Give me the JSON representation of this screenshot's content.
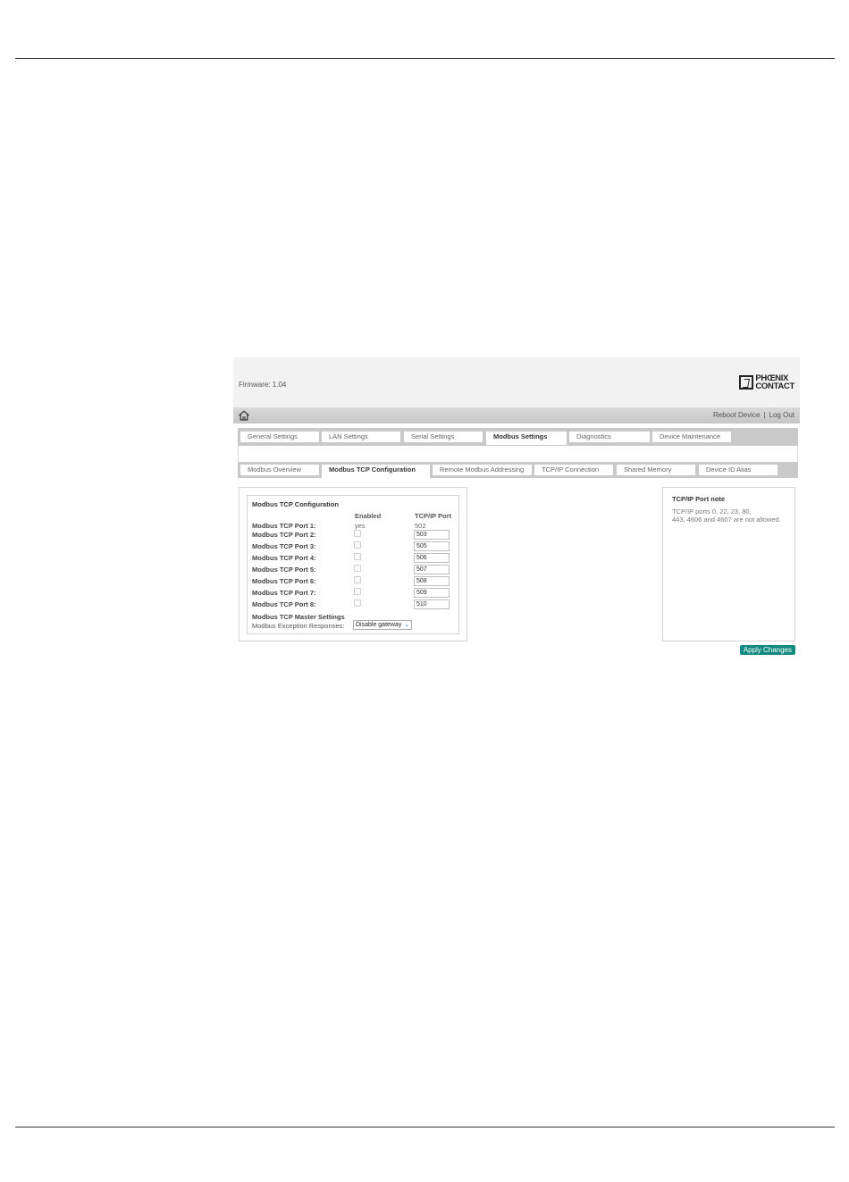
{
  "header": {
    "firmware": "Firmware: 1.04",
    "logo_line1": "PHŒNIX",
    "logo_line2": "CONTACT"
  },
  "toolbar": {
    "reboot": "Reboot Device",
    "separator": "|",
    "logout": "Log Out"
  },
  "main_tabs": [
    {
      "label": "General Settings",
      "active": false
    },
    {
      "label": "LAN Settings",
      "active": false
    },
    {
      "label": "Serial Settings",
      "active": false
    },
    {
      "label": "Modbus Settings",
      "active": true
    },
    {
      "label": "Diagnostics",
      "active": false
    },
    {
      "label": "Device Maintenance",
      "active": false
    }
  ],
  "sub_tabs": [
    {
      "label": "Modbus Overview",
      "active": false
    },
    {
      "label": "Modbus TCP Configuration",
      "active": true
    },
    {
      "label": "Remote Modbus Addressing",
      "active": false
    },
    {
      "label": "TCP/IP Connection",
      "active": false
    },
    {
      "label": "Shared Memory",
      "active": false
    },
    {
      "label": "Device ID Alias",
      "active": false
    }
  ],
  "config": {
    "title": "Modbus TCP Configuration",
    "col_enabled": "Enabled",
    "col_port": "TCP/IP Port",
    "ports": [
      {
        "label": "Modbus TCP Port 1:",
        "enabled_text": "yes",
        "port": "502"
      },
      {
        "label": "Modbus TCP Port 2:",
        "enabled": false,
        "port": "503"
      },
      {
        "label": "Modbus TCP Port 3:",
        "enabled": false,
        "port": "505"
      },
      {
        "label": "Modbus TCP Port 4:",
        "enabled": false,
        "port": "506"
      },
      {
        "label": "Modbus TCP Port 5:",
        "enabled": false,
        "port": "507"
      },
      {
        "label": "Modbus TCP Port 6:",
        "enabled": false,
        "port": "508"
      },
      {
        "label": "Modbus TCP Port 7:",
        "enabled": false,
        "port": "509"
      },
      {
        "label": "Modbus TCP Port 8:",
        "enabled": false,
        "port": "510"
      }
    ],
    "master_title": "Modbus TCP Master Settings",
    "exception_label": "Modbus Exception Responses:",
    "exception_value": "Disable gateway"
  },
  "note": {
    "title": "TCP/IP Port note",
    "line1": "TCP/IP ports 0, 22, 23, 80,",
    "line2": "443, 4606 and 4607 are not allowed."
  },
  "apply_label": "Apply Changes"
}
